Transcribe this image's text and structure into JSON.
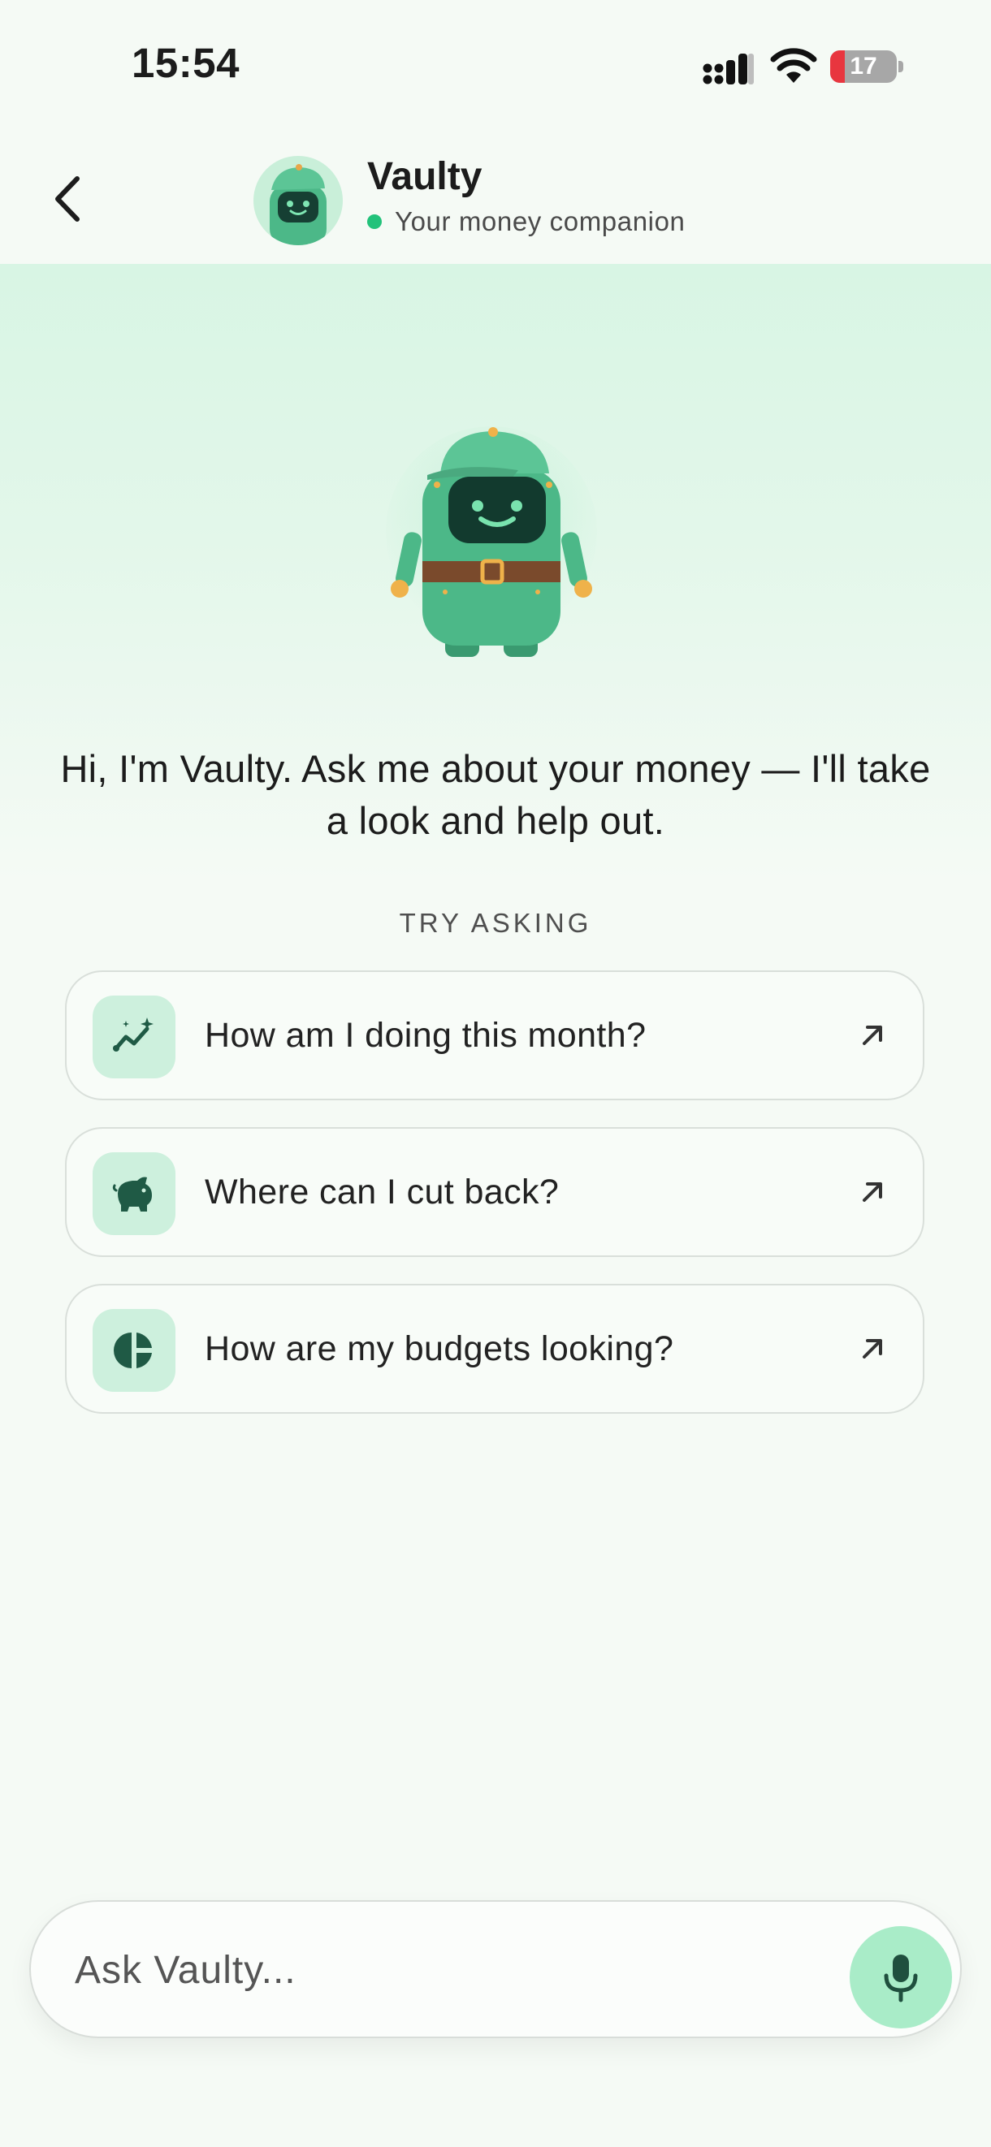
{
  "status_bar": {
    "time": "15:54",
    "battery": "17",
    "battery_color": "#e8363f"
  },
  "header": {
    "back_icon": "chevron-left-icon",
    "name": "Vaulty",
    "subtitle": "Your money companion",
    "online_color": "#22c27a"
  },
  "hero": {
    "mascot": "robot-mascot",
    "greeting": "Hi, I'm Vaulty. Ask me about your money — I'll take a look and help out."
  },
  "suggestions": {
    "label": "TRY ASKING",
    "items": [
      {
        "icon": "sparkle-trend-icon",
        "text": "How am I doing this month?"
      },
      {
        "icon": "piggy-bank-icon",
        "text": "Where can I cut back?"
      },
      {
        "icon": "pie-chart-icon",
        "text": "How are my budgets looking?"
      }
    ]
  },
  "composer": {
    "placeholder": "Ask Vaulty...",
    "mic_icon": "microphone-icon"
  },
  "colors": {
    "accent": "#22c27a",
    "accent_soft": "#cdf0dd",
    "mic_bg": "#a9ecc8",
    "mascot_body": "#4cb888",
    "background": "#f5faf5"
  }
}
